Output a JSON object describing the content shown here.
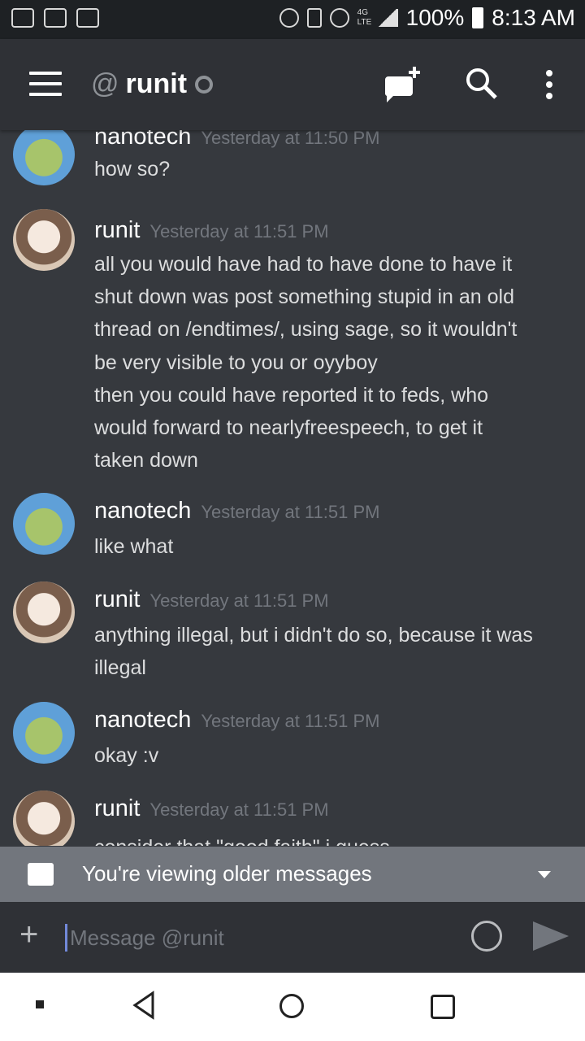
{
  "status_bar": {
    "battery": "100%",
    "time": "8:13 AM",
    "network": "4G LTE"
  },
  "app_bar": {
    "at": "@",
    "title": "runit"
  },
  "messages": [
    {
      "author": "nanotech",
      "time": "Yesterday at 11:50 PM",
      "avatar": "nanotech-avatar",
      "lines": [
        "how so?"
      ]
    },
    {
      "author": "runit",
      "time": "Yesterday at 11:51 PM",
      "avatar": "runit-avatar",
      "lines": [
        "all you would have had to have done to have it",
        "shut down was post something stupid in an old",
        "thread on /endtimes/, using sage, so it wouldn't",
        "be very visible to you or oyyboy",
        "then you could have reported  it to feds, who",
        "would forward to nearlyfreespeech, to get it",
        "taken down"
      ]
    },
    {
      "author": "nanotech",
      "time": "Yesterday at 11:51 PM",
      "avatar": "nanotech-avatar",
      "lines": [
        "like what"
      ]
    },
    {
      "author": "runit",
      "time": "Yesterday at 11:51 PM",
      "avatar": "runit-avatar",
      "lines": [
        "anything illegal, but i didn't do so, because it was",
        "illegal"
      ]
    },
    {
      "author": "nanotech",
      "time": "Yesterday at 11:51 PM",
      "avatar": "nanotech-avatar",
      "lines": [
        "okay :v"
      ]
    },
    {
      "author": "runit",
      "time": "Yesterday at 11:51 PM",
      "avatar": "runit-avatar",
      "lines": [
        "consider that \"good faith\" i guess"
      ]
    }
  ],
  "older_banner": {
    "text": "You're viewing older messages"
  },
  "composer": {
    "placeholder": "Message @runit"
  },
  "colors": {
    "background": "#36393e",
    "app_bar": "#2f3136",
    "accent": "#7289da",
    "banner": "#72767d"
  }
}
